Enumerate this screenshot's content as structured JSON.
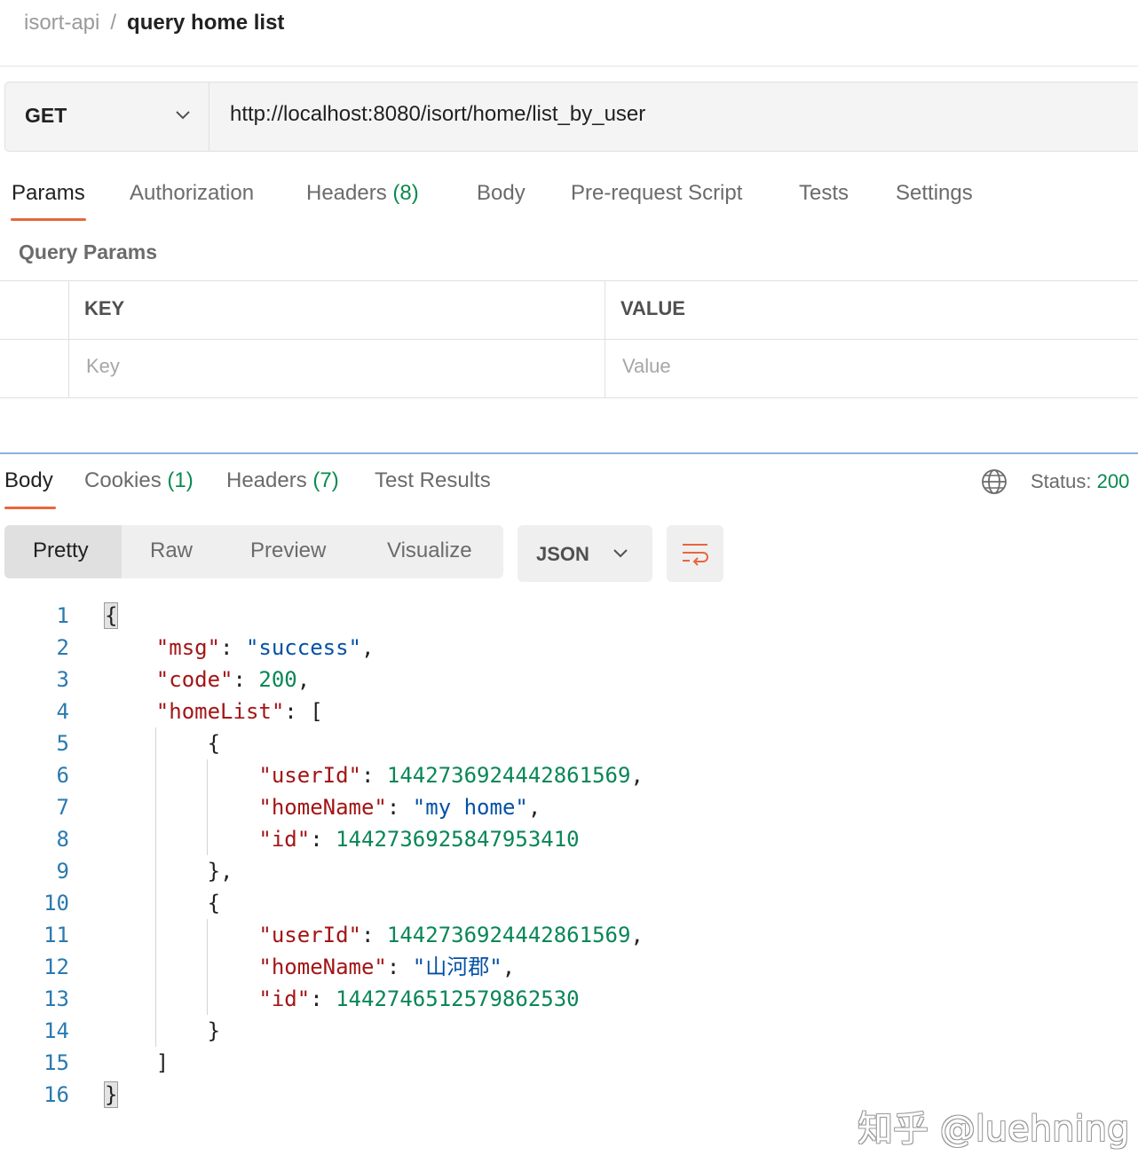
{
  "breadcrumb": {
    "parent": "isort-api",
    "separator": "/",
    "current": "query home list"
  },
  "request": {
    "method": "GET",
    "url": "http://localhost:8080/isort/home/list_by_user"
  },
  "request_tabs": {
    "params": "Params",
    "authorization": "Authorization",
    "headers": "Headers",
    "headers_count": "(8)",
    "body": "Body",
    "prerequest": "Pre-request Script",
    "tests": "Tests",
    "settings": "Settings"
  },
  "query_params": {
    "title": "Query Params",
    "col_key": "KEY",
    "col_value": "VALUE",
    "key_placeholder": "Key",
    "value_placeholder": "Value"
  },
  "response_tabs": {
    "body": "Body",
    "cookies": "Cookies",
    "cookies_count": "(1)",
    "headers": "Headers",
    "headers_count": "(7)",
    "test_results": "Test Results"
  },
  "status": {
    "label": "Status:",
    "code": "200"
  },
  "view_modes": {
    "pretty": "Pretty",
    "raw": "Raw",
    "preview": "Preview",
    "visualize": "Visualize"
  },
  "format": {
    "selected": "JSON"
  },
  "code_lines": {
    "l1": "{",
    "l2_key": "\"msg\"",
    "l2_val": "\"success\"",
    "l3_key": "\"code\"",
    "l3_val": "200",
    "l4_key": "\"homeList\"",
    "l4_rest": ": [",
    "l5": "{",
    "l6_key": "\"userId\"",
    "l6_val": "1442736924442861569",
    "l7_key": "\"homeName\"",
    "l7_val": "\"my home\"",
    "l8_key": "\"id\"",
    "l8_val": "1442736925847953410",
    "l9": "},",
    "l10": "{",
    "l11_key": "\"userId\"",
    "l11_val": "1442736924442861569",
    "l12_key": "\"homeName\"",
    "l12_val": "\"山河郡\"",
    "l13_key": "\"id\"",
    "l13_val": "1442746512579862530",
    "l14": "}",
    "l15": "]",
    "l16": "}"
  },
  "line_numbers": [
    "1",
    "2",
    "3",
    "4",
    "5",
    "6",
    "7",
    "8",
    "9",
    "10",
    "11",
    "12",
    "13",
    "14",
    "15",
    "16"
  ],
  "watermark": "知乎 @luehning",
  "colors": {
    "accent": "#e8663c",
    "count_green": "#0a8a4f",
    "json_key": "#a31515",
    "json_string": "#0451a5",
    "json_number": "#098658",
    "line_number": "#2a7ab0"
  }
}
